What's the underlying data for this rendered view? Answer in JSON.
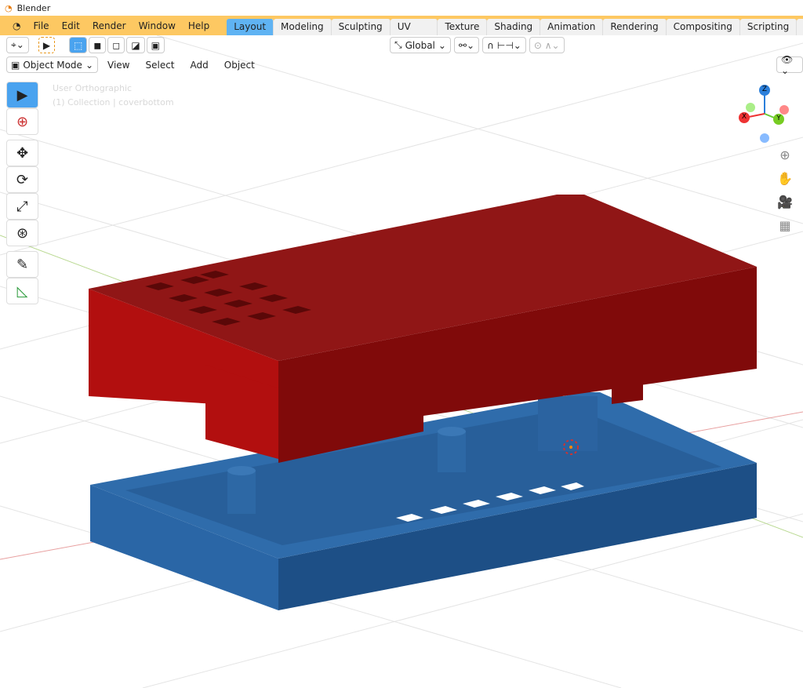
{
  "window": {
    "title": "Blender"
  },
  "menu": [
    "File",
    "Edit",
    "Render",
    "Window",
    "Help"
  ],
  "tabs": [
    {
      "label": "Layout",
      "active": true
    },
    {
      "label": "Modeling"
    },
    {
      "label": "Sculpting"
    },
    {
      "label": "UV Editing"
    },
    {
      "label": "Texture Paint"
    },
    {
      "label": "Shading"
    },
    {
      "label": "Animation"
    },
    {
      "label": "Rendering"
    },
    {
      "label": "Compositing"
    },
    {
      "label": "Scripting"
    },
    {
      "label": "+"
    }
  ],
  "toolheader": {
    "orientation": "Global"
  },
  "viewheader": {
    "mode": "Object Mode",
    "menus": [
      "View",
      "Select",
      "Add",
      "Object"
    ]
  },
  "overlay": {
    "view_name": "User Orthographic",
    "collection": "(1) Collection | coverbottom"
  },
  "gizmo": {
    "x": "X",
    "y": "Y",
    "z": "Z"
  },
  "colors": {
    "header": "#fdc862",
    "active_tab": "#5fb3f3",
    "cover": "#8f1515",
    "base": "#2d6aa8"
  }
}
